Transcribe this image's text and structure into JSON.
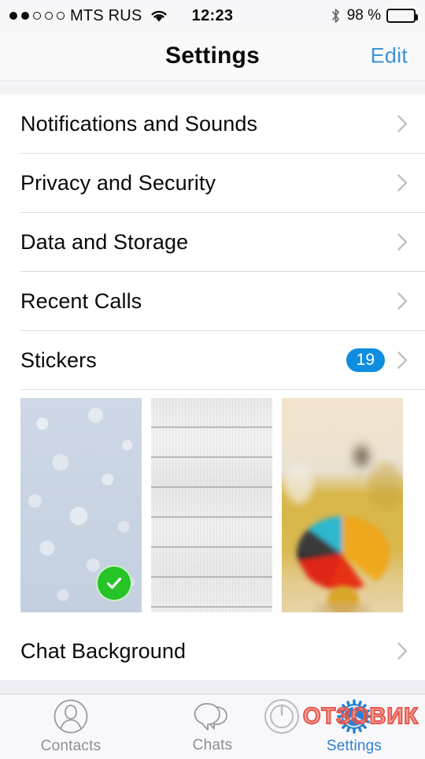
{
  "status_bar": {
    "signal_dots_total": 5,
    "signal_dots_filled": 2,
    "carrier": "MTS RUS",
    "wifi_icon": "wifi-icon",
    "time": "12:23",
    "bluetooth_icon": "bluetooth-icon",
    "battery_percent": "98 %",
    "battery_level": 98
  },
  "nav": {
    "title": "Settings",
    "edit_label": "Edit",
    "edit_color": "#3d93d4"
  },
  "settings_rows": [
    {
      "label": "Notifications and Sounds",
      "badge": null
    },
    {
      "label": "Privacy and Security",
      "badge": null
    },
    {
      "label": "Data and Storage",
      "badge": null
    },
    {
      "label": "Recent Calls",
      "badge": null
    },
    {
      "label": "Stickers",
      "badge": "19"
    }
  ],
  "badge_color": "#0f8ee0",
  "wallpapers": [
    {
      "name": "doodle-pattern-wallpaper",
      "selected": true,
      "check_color": "#26c426"
    },
    {
      "name": "white-wood-planks-wallpaper",
      "selected": false,
      "check_color": null
    },
    {
      "name": "colorful-umbrella-photo-wallpaper",
      "selected": false,
      "check_color": null
    }
  ],
  "chat_background_row": {
    "label": "Chat Background"
  },
  "tabs": [
    {
      "label": "Contacts",
      "icon": "contacts-icon",
      "active": false
    },
    {
      "label": "Chats",
      "icon": "chats-icon",
      "active": true
    },
    {
      "label": "Settings",
      "icon": "gear-icon",
      "active": true
    }
  ],
  "watermark": {
    "text": "ОТЗОВИК",
    "logo": "power-circle-logo",
    "color": "#e8564a"
  }
}
